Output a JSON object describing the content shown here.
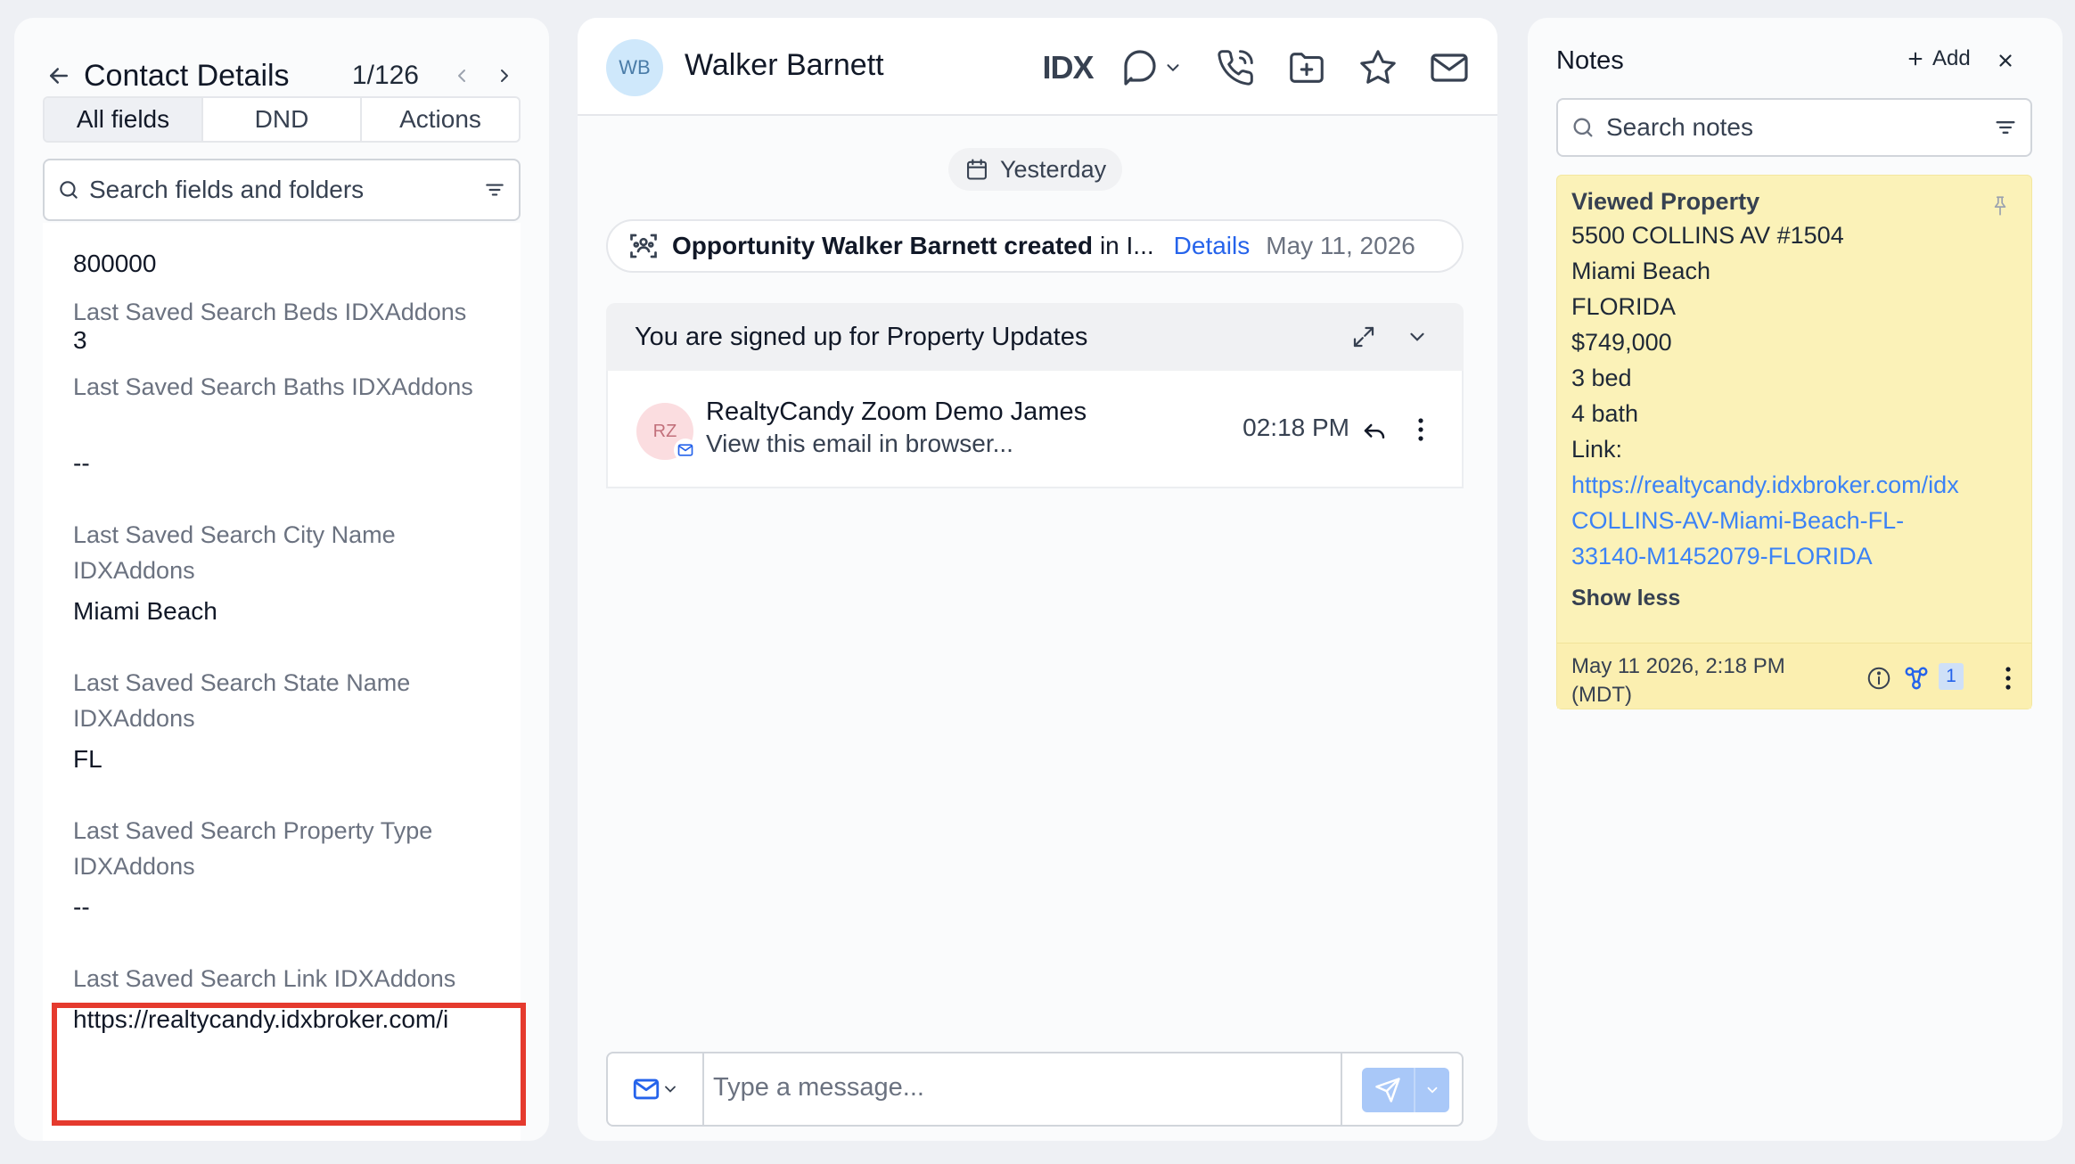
{
  "left_panel": {
    "title": "Contact Details",
    "record_counter": "1/126",
    "tabs": [
      "All fields",
      "DND",
      "Actions"
    ],
    "search_placeholder": "Search fields and folders",
    "fields": [
      {
        "label": "",
        "value": "800000"
      },
      {
        "label": "Last Saved Search Beds IDXAddons",
        "value": "3"
      },
      {
        "label": "Last Saved Search Baths IDXAddons",
        "value": "--"
      },
      {
        "label": "Last Saved Search City Name IDXAddons",
        "value": "Miami Beach"
      },
      {
        "label": "Last Saved Search State Name IDXAddons",
        "value": "FL"
      },
      {
        "label": "Last Saved Search Property Type IDXAddons",
        "value": "--"
      },
      {
        "label": "Last Saved Search Link IDXAddons",
        "value": "https://realtycandy.idxbroker.com/i"
      }
    ],
    "highlight_color": "#e53a2e"
  },
  "middle_panel": {
    "avatar_initials": "WB",
    "contact_name": "Walker Barnett",
    "idx_logo": "IDX",
    "date_chip": "Yesterday",
    "opportunity": {
      "text": "Opportunity Walker Barnett created",
      "suffix": "in I...",
      "details_label": "Details",
      "date": "May 11, 2026"
    },
    "property_updates": {
      "header": "You are signed up for Property Updates",
      "avatar_initials": "RZ",
      "from": "RealtyCandy Zoom Demo James",
      "snippet": "View this email in browser...",
      "time": "02:18 PM"
    },
    "composer": {
      "placeholder": "Type a message..."
    },
    "accent_color": "#2563eb"
  },
  "right_panel": {
    "title": "Notes",
    "add_label": "Add",
    "search_placeholder": "Search notes",
    "note": {
      "title": "Viewed Property",
      "lines": [
        "5500  COLLINS AV #1504",
        "Miami Beach",
        "FLORIDA",
        "$749,000",
        "3 bed",
        "4 bath",
        "Link:"
      ],
      "link_lines": [
        "https://realtycandy.idxbroker.com/idx",
        "COLLINS-AV-Miami-Beach-FL-",
        "33140-M1452079-FLORIDA"
      ],
      "show_less_label": "Show less",
      "timestamp": "May 11 2026, 2:18 PM (MDT)",
      "link_count": "1",
      "background_color": "#fbf2b8"
    }
  }
}
